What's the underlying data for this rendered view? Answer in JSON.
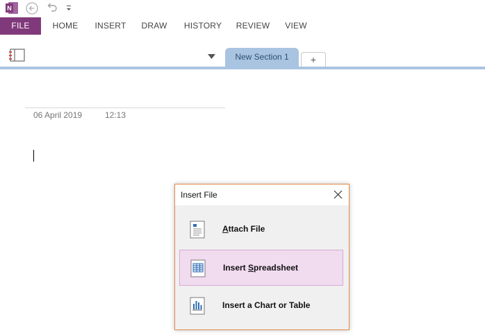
{
  "quick_access": {
    "logo_icon": "onenote-logo-icon",
    "back_icon": "back-arrow-icon",
    "undo_icon": "undo-icon",
    "customize_icon": "customize-toolbar-icon"
  },
  "ribbon": {
    "tabs": [
      "FILE",
      "HOME",
      "INSERT",
      "DRAW",
      "HISTORY",
      "REVIEW",
      "VIEW"
    ],
    "file_color": "#80397b"
  },
  "notebook": {
    "notebook_icon": "notebook-icon",
    "section_tab": "New Section 1",
    "add_tab_label": "+",
    "section_color": "#a9c4e0"
  },
  "page": {
    "date": "06 April 2019",
    "time": "12:13"
  },
  "dialog": {
    "title": "Insert File",
    "close_icon": "close-icon",
    "options": [
      {
        "mnemonic": "A",
        "rest": "ttach File",
        "icon": "document-icon",
        "selected": false
      },
      {
        "pre": "Insert ",
        "mnemonic": "S",
        "rest": "preadsheet",
        "icon": "spreadsheet-icon",
        "selected": true
      },
      {
        "pre": "Insert a Chart or Table",
        "icon": "chart-icon",
        "selected": false
      }
    ],
    "border_color": "#e08a4b",
    "selected_color": "#f1dbef"
  }
}
